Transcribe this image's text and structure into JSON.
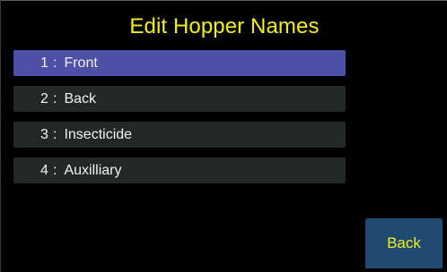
{
  "screen": {
    "title": "Edit Hopper Names"
  },
  "hoppers": [
    {
      "index": "1",
      "separator": ":",
      "name": "Front",
      "selected": true
    },
    {
      "index": "2",
      "separator": ":",
      "name": "Back",
      "selected": false
    },
    {
      "index": "3",
      "separator": ":",
      "name": "Insecticide",
      "selected": false
    },
    {
      "index": "4",
      "separator": ":",
      "name": "Auxilliary",
      "selected": false
    }
  ],
  "buttons": {
    "back_label": "Back"
  },
  "colors": {
    "background": "#000000",
    "title_text": "#f4ef1a",
    "row_default": "#222826",
    "row_selected": "#4e4fa7",
    "row_text": "#f2f2f2",
    "back_button_bg": "#1f4b73",
    "back_button_text": "#f4ef1a"
  }
}
